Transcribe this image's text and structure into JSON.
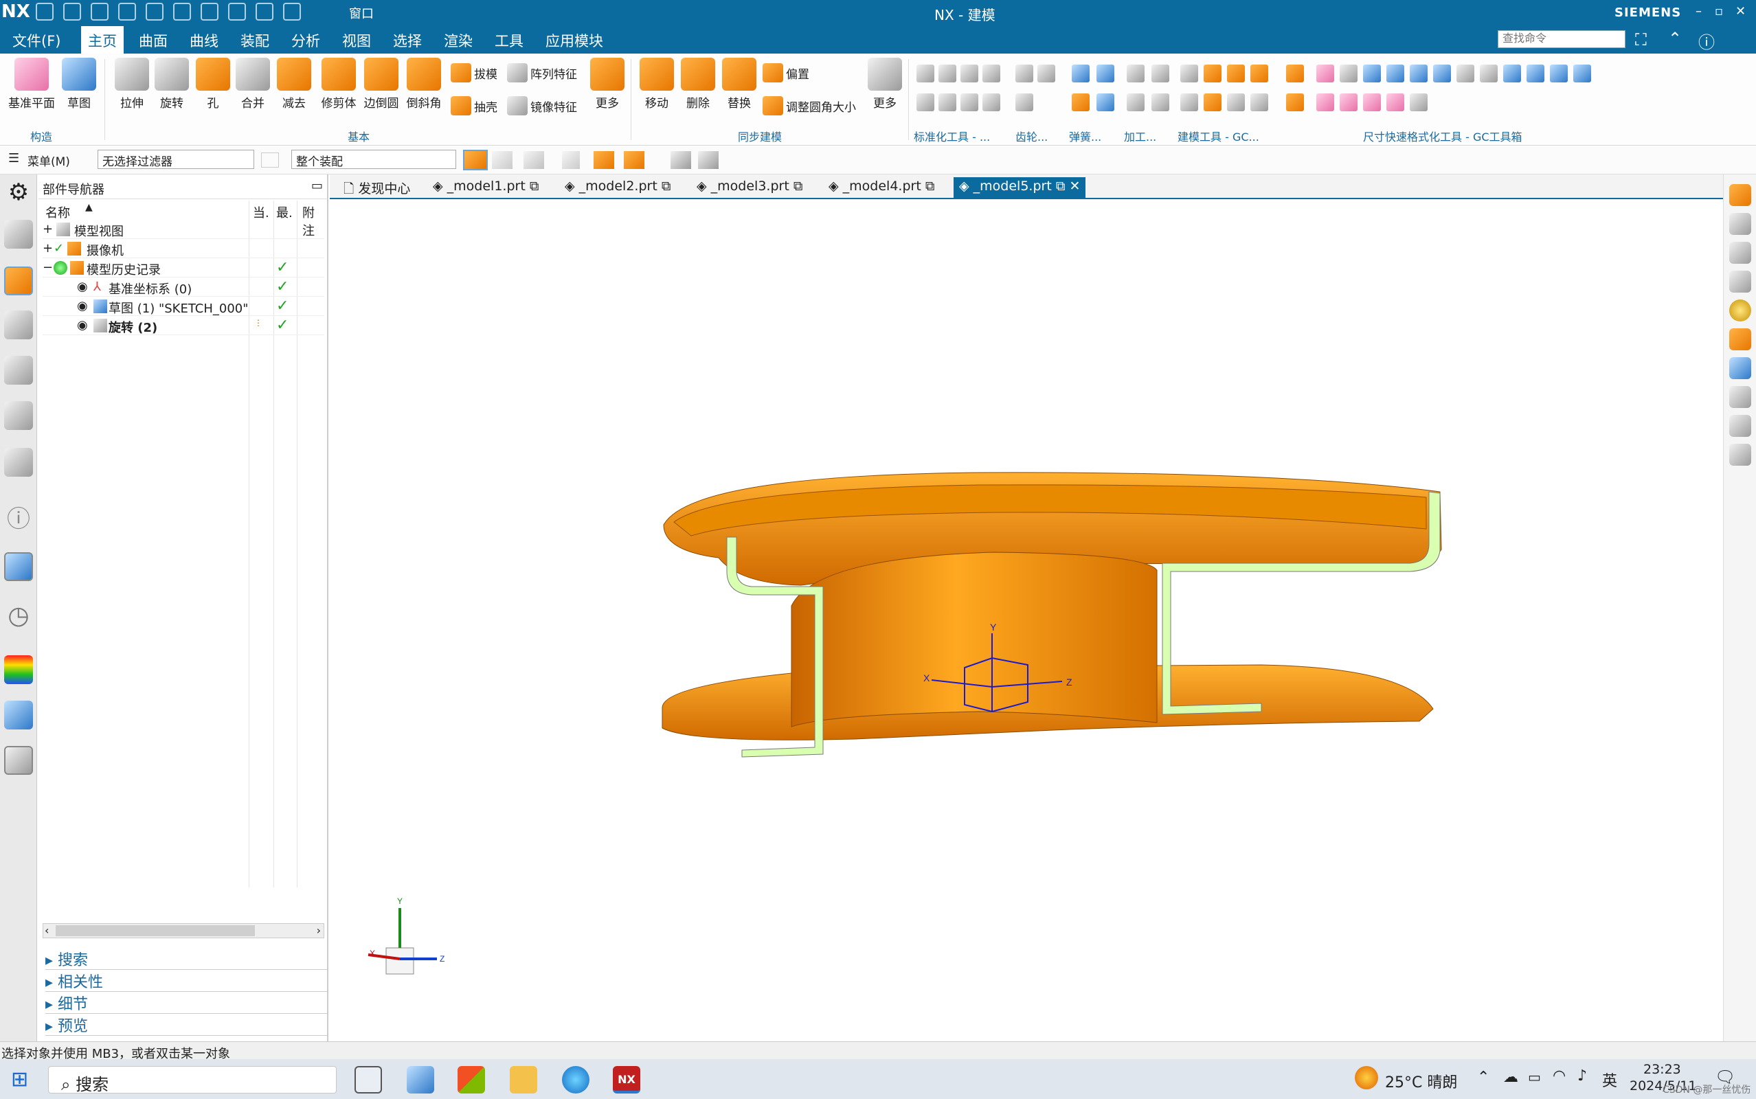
{
  "titlebar": {
    "logo": "NX",
    "title": "NX - 建模",
    "brand": "SIEMENS",
    "window_menu": "窗口"
  },
  "menu": {
    "items": [
      "文件(F)",
      "主页",
      "曲面",
      "曲线",
      "装配",
      "分析",
      "视图",
      "选择",
      "渲染",
      "工具",
      "应用模块"
    ],
    "active": "主页",
    "search_placeholder": "查找命令"
  },
  "ribbon": {
    "construct": {
      "group": "构造",
      "buttons": [
        "基准平面",
        "草图"
      ]
    },
    "basic": {
      "group": "基本",
      "buttons": [
        "拉伸",
        "旋转",
        "孔",
        "合并",
        "减去",
        "修剪体",
        "边倒圆",
        "倒斜角",
        "更多"
      ],
      "small": [
        "拔模",
        "阵列特征",
        "抽壳",
        "镜像特征"
      ]
    },
    "sync": {
      "group": "同步建模",
      "buttons": [
        "移动",
        "删除",
        "替换",
        "更多"
      ],
      "small": [
        "偏置",
        "调整圆角大小"
      ]
    },
    "groups_right": [
      "标准化工具 - ...",
      "齿轮...",
      "弹簧...",
      "加工...",
      "建模工具 - GC...",
      "尺寸快速格式化工具 - GC工具箱"
    ]
  },
  "toolbar": {
    "menu_label": "菜单(M)",
    "filter": "无选择过滤器",
    "scope": "整个装配"
  },
  "navigator": {
    "title": "部件导航器",
    "columns": [
      "名称",
      "当.",
      "最.",
      "附注"
    ],
    "rows": [
      {
        "label": "模型视图",
        "check": false
      },
      {
        "label": "摄像机",
        "check": false
      },
      {
        "label": "模型历史记录",
        "check": true
      },
      {
        "label": "基准坐标系 (0)",
        "check": true
      },
      {
        "label": "草图 (1) \"SKETCH_000\"",
        "check": true
      },
      {
        "label": "旋转 (2)",
        "check": true
      }
    ],
    "sections": [
      "搜索",
      "相关性",
      "细节",
      "预览"
    ]
  },
  "tabs": [
    "发现中心",
    "_model1.prt",
    "_model2.prt",
    "_model3.prt",
    "_model4.prt",
    "_model5.prt"
  ],
  "active_tab": "_model5.prt",
  "axes": {
    "x": "X",
    "y": "Y",
    "z": "Z"
  },
  "status_text": "选择对象并使用 MB3，或者双击某一对象",
  "taskbar": {
    "search": "搜索",
    "weather": "25°C  晴朗",
    "ime": "英",
    "time": "23:23",
    "date": "2024/5/11",
    "watermark": "CSDN @那一丝忧伤"
  },
  "colors": {
    "accent": "#0b6a9e",
    "model": "#f29a10",
    "section": "#d9ffb0"
  }
}
